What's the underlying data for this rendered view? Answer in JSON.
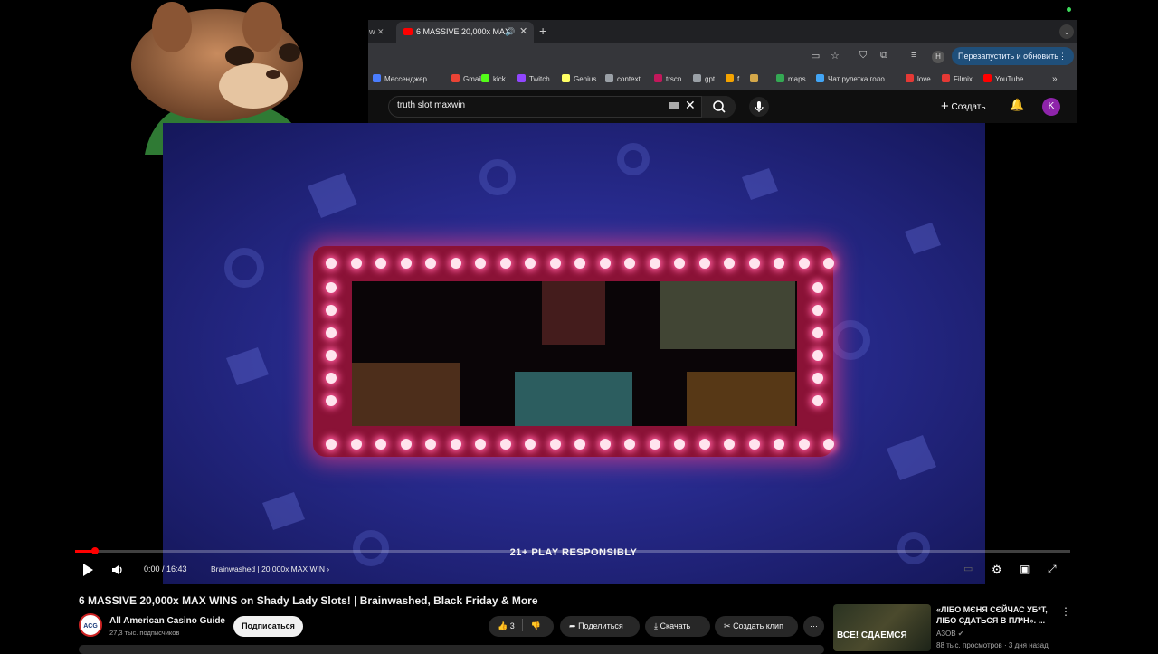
{
  "browser": {
    "tab_left_partial": "w",
    "active_tab_title": "6 MASSIVE 20,000x MAX",
    "relaunch_label": "Перезапустить и обновить",
    "profile_initial": "H",
    "bookmarks": [
      {
        "label": "Мессенджер",
        "color": "#4a7dff"
      },
      {
        "label": "Gmail",
        "color": "#ea4335"
      },
      {
        "label": "kick",
        "color": "#53fc18"
      },
      {
        "label": "Twitch",
        "color": "#9146ff"
      },
      {
        "label": "Genius",
        "color": "#ffff64"
      },
      {
        "label": "context",
        "color": "#9aa0a6"
      },
      {
        "label": "trscn",
        "color": "#c2185b"
      },
      {
        "label": "gpt",
        "color": "#9aa0a6"
      },
      {
        "label": "f",
        "color": "#f4a300"
      },
      {
        "label": "",
        "color": "#d4a84a"
      },
      {
        "label": "maps",
        "color": "#34a853"
      },
      {
        "label": "Чат рулетка голо...",
        "color": "#42a5f5"
      },
      {
        "label": "love",
        "color": "#e53935"
      },
      {
        "label": "Filmix",
        "color": "#e53935"
      },
      {
        "label": "YouTube",
        "color": "#ff0000"
      }
    ]
  },
  "youtube": {
    "search_query": "truth slot maxwin",
    "create_label": "Создать",
    "user_initial": "K"
  },
  "player": {
    "tagline": "21+ PLAY RESPONSIBLY",
    "time": "0:00 / 16:43",
    "chapter": "Brainwashed | 20,000x MAX WIN",
    "progress": 0.02
  },
  "video": {
    "title": "6 MASSIVE 20,000x MAX WINS on Shady Lady Slots! | Brainwashed, Black Friday & More",
    "channel_name": "All American Casino Guide",
    "channel_subs": "27,3 тыс. подписчиков",
    "channel_avatar_text": "ACG",
    "subscribe_label": "Подписаться",
    "likes": "3",
    "share_label": "Поделиться",
    "download_label": "Скачать",
    "clip_label": "Создать клип"
  },
  "recommended": {
    "title": "«ЛІБО МЄНЯ СЄЙЧАС УБ*Т, ЛІБО СДАТЬСЯ В ПЛ*Н». ...",
    "channel": "АЗОВ",
    "meta": "88 тыс. просмотров · 3 дня назад",
    "thumb_text": "ВСЕ! СДАЕМСЯ"
  },
  "colors": {
    "accent": "#ff0000",
    "marquee": "#8a1236",
    "video_bg": "#272a8c"
  }
}
